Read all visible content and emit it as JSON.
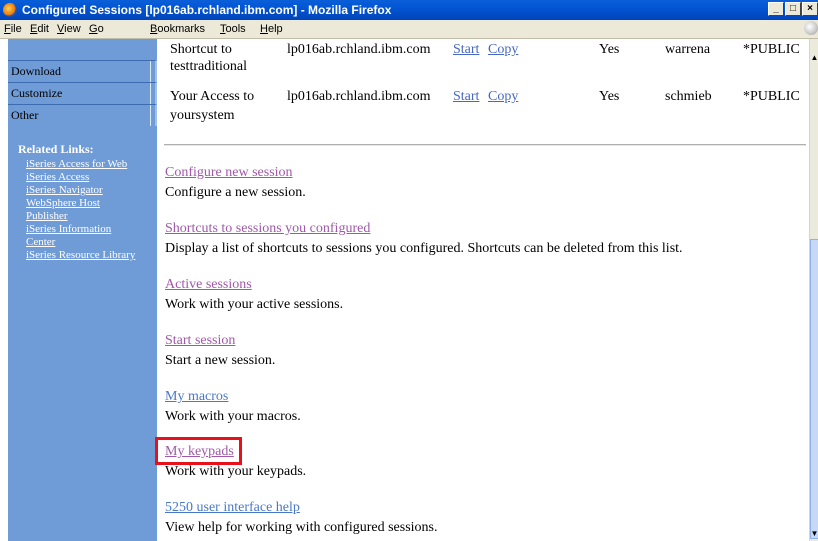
{
  "window": {
    "title": "Configured Sessions [lp016ab.rchland.ibm.com] - Mozilla Firefox",
    "buttons": {
      "minimize": "_",
      "maximize": "□",
      "close": "×"
    }
  },
  "menubar": {
    "items": [
      {
        "accel": "F",
        "rest": "ile"
      },
      {
        "accel": "E",
        "rest": "dit"
      },
      {
        "accel": "V",
        "rest": "iew"
      },
      {
        "accel": "G",
        "rest": "o"
      },
      {
        "accel": "B",
        "rest": "ookmarks"
      },
      {
        "accel": "T",
        "rest": "ools"
      },
      {
        "accel": "H",
        "rest": "elp"
      }
    ]
  },
  "sidebar": {
    "tabs": [
      "Download",
      "Customize",
      "Other"
    ],
    "related_title": "Related Links:",
    "related_links": [
      "iSeries Access for Web",
      "iSeries Access",
      "iSeries Navigator",
      "WebSphere Host",
      "Publisher",
      "iSeries Information",
      "Center",
      "iSeries Resource Library"
    ]
  },
  "table": {
    "partial_row": {
      "name_line1": "Shortcut to",
      "name_line2": "testtraditional",
      "host": "lp016ab.rchland.ibm.com",
      "start": "Start",
      "copy": "Copy",
      "shared": "Yes",
      "owner": "warrena",
      "access": "*PUBLIC"
    },
    "row": {
      "name_line1": "Your Access to",
      "name_line2": "yoursystem",
      "host": "lp016ab.rchland.ibm.com",
      "start": "Start",
      "copy": "Copy",
      "shared": "Yes",
      "owner": "schmieb",
      "access": "*PUBLIC"
    }
  },
  "actions": [
    {
      "link": "Configure new session",
      "desc": "Configure a new session."
    },
    {
      "link": "Shortcuts to sessions you configured",
      "desc": "Display a list of shortcuts to sessions you configured. Shortcuts can be deleted from this list."
    },
    {
      "link": "Active sessions",
      "desc": "Work with your active sessions."
    },
    {
      "link": "Start session",
      "desc": "Start a new session."
    },
    {
      "link": "My macros",
      "desc": "Work with your macros."
    },
    {
      "link": "My keypads",
      "desc": "Work with your keypads."
    },
    {
      "link": "5250 user interface help",
      "desc": "View help for working with configured sessions."
    }
  ],
  "colors": {
    "sidebar": "#6f9bd7",
    "visited_link": "#a058a8",
    "link": "#4668c2",
    "highlight": "#e8101a"
  }
}
